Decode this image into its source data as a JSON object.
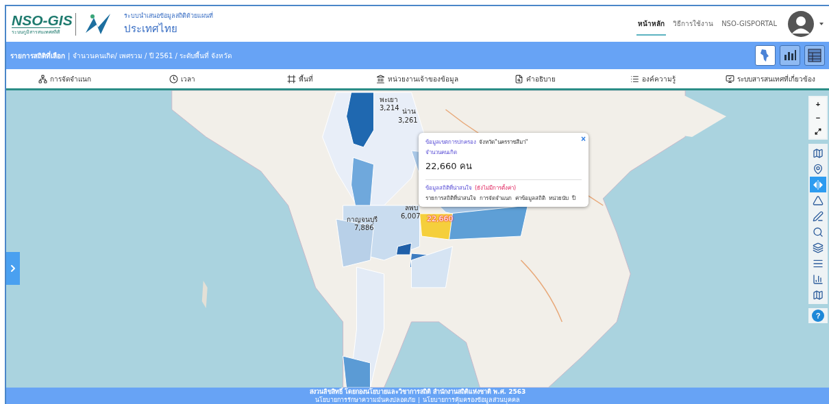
{
  "header": {
    "logo": {
      "name": "NSO-GIS",
      "tagline": "ระบบภูมิสารสนเทศสถิติ"
    },
    "subtitle": "ระบบนำเสนอข้อมูลสถิติด้วยแผนที่",
    "title": "ประเทศไทย",
    "nav": [
      {
        "label": "หน้าหลัก",
        "selected": true
      },
      {
        "label": "วิธีการใช้งาน",
        "selected": false
      },
      {
        "label": "NSO-GISPORTAL",
        "selected": false
      }
    ]
  },
  "selection_bar": {
    "label": "รายการสถิติที่เลือก",
    "separator": "|",
    "text": "จำนวนคนเกิด/ เพศรวม / ปี 2561 / ระดับพื้นที่ จังหวัด",
    "views": [
      {
        "kind": "map",
        "selected": true
      },
      {
        "kind": "chart",
        "selected": false
      },
      {
        "kind": "table",
        "selected": false
      }
    ]
  },
  "menu": [
    "การจัดจำแนก",
    "เวลา",
    "พื้นที่",
    "หน่วยงานเจ้าของข้อมูล",
    "คำอธิบาย",
    "องค์ความรู้",
    "ระบบสารสนเทศที่เกี่ยวข้อง"
  ],
  "map": {
    "labels": [
      {
        "name": "พะเยา",
        "value": "3,214"
      },
      {
        "name": "น่าน",
        "value": "3,261"
      },
      {
        "name": "ลพบ",
        "value": "6,007"
      },
      {
        "name": "กาญจนบุรี",
        "value": "7,886"
      }
    ],
    "highlight": {
      "value": "22,660"
    },
    "popup": {
      "heading": "ข้อมูลเขตการปกครอง",
      "province": "จังหวัด\"นครราชสีมา\"",
      "indicator": "จำนวนคนเกิด",
      "value": "22,660 คน",
      "close": "×",
      "section": "ข้อมูลสถิติที่น่าสนใจ",
      "note": "(ยังไม่มีการตั้งค่า)",
      "columns": "รายการสถิติที่น่าสนใจ  การจัดจำแนก  ค่าข้อมูลสถิติ  หน่วยนับ  ปี"
    },
    "zoom": [
      "+",
      "−"
    ],
    "tools": [
      {
        "selected": false
      },
      {
        "selected": false
      },
      {
        "selected": true
      },
      {
        "selected": false
      },
      {
        "selected": false
      },
      {
        "selected": false
      },
      {
        "selected": false
      },
      {
        "selected": false
      },
      {
        "selected": false
      },
      {
        "selected": false
      }
    ],
    "help": "?"
  },
  "footer": {
    "copyright": "สงวนลิขสิทธิ์ โดยกองนโยบายและวิชาการสถิติ สำนักงานสถิติแห่งชาติ พ.ศ. 2563",
    "links": [
      "นโยบายการรักษาความมั่นคงปลอดภัย",
      "นโยบายการคุ้มครองข้อมูลส่วนบุคคล"
    ],
    "link_separator": "|"
  }
}
